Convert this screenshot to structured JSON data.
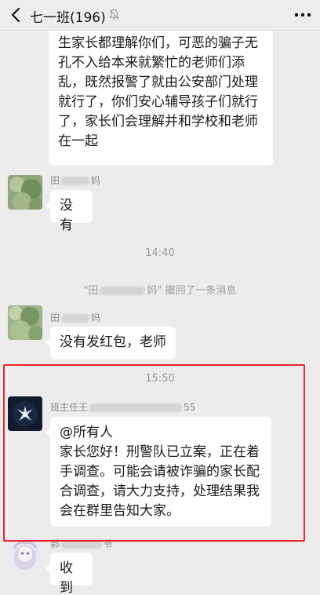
{
  "header": {
    "title": "七一班(196)"
  },
  "messages": {
    "m1": {
      "lines": [
        "生家长都理解你们，可恶的骗子无",
        "孔不入给本来就繁忙的老师们添",
        "乱，既然报警了就由公安部门处理",
        "就行了，你们安心辅导孩子们就行",
        "了，家长们会理解并和学校和老师",
        "在一起"
      ]
    },
    "m2": {
      "sender_prefix": "田",
      "sender_suffix": "妈",
      "text": "没有"
    },
    "time1": "14:40",
    "recall": {
      "prefix": "\"田",
      "suffix": "妈\" 撤回了一条消息"
    },
    "m3": {
      "sender_prefix": "田",
      "sender_suffix": "妈",
      "text": "没有发红包，老师"
    },
    "time2": "15:50",
    "m4": {
      "sender_prefix": "班主任王",
      "sender_suffix": "55",
      "lines": [
        "@所有人",
        "家长您好！刑警队已立案，正在着",
        "手调查。可能会请被诈骗的家长配",
        "合调查，请大力支持，处理结果我",
        "会在群里告知大家。"
      ]
    },
    "m5": {
      "sender_prefix": "郭",
      "sender_suffix": "爷",
      "text": "收到"
    }
  },
  "colors": {
    "background": "#ececec",
    "bubble": "#ffffff",
    "highlight_border": "#e8262b"
  }
}
